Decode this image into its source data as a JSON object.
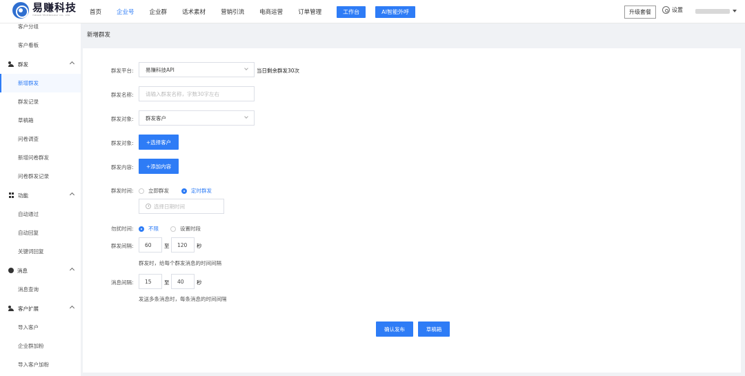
{
  "brand": {
    "name": "易赚科技",
    "sub": "YIZUAN TECHNOLOGY CO., LTD."
  },
  "nav": {
    "items": [
      "首页",
      "企业号",
      "企业群",
      "话术素材",
      "营销引流",
      "电商运营",
      "订单管理"
    ],
    "workbench": "工作台",
    "ai_call": "AI智能外呼",
    "upgrade": "升级套餐",
    "settings": "设置"
  },
  "sidebar": {
    "top_items": [
      "客户分组",
      "客户看板"
    ],
    "groups": [
      {
        "title": "群发",
        "icon": "users-icon",
        "items": [
          "新增群发",
          "群发记录",
          "草稿箱",
          "问卷调查",
          "新增问卷群发",
          "问卷群发记录"
        ]
      },
      {
        "title": "功能",
        "icon": "grid-icon",
        "items": [
          "自动通过",
          "自动回复",
          "关键词回复"
        ]
      },
      {
        "title": "消息",
        "icon": "message-icon",
        "items": [
          "消息查询"
        ]
      },
      {
        "title": "客户扩展",
        "icon": "user-add-icon",
        "items": [
          "导入客户",
          "企业群加粉",
          "导入客户加粉"
        ]
      }
    ]
  },
  "page": {
    "title": "新增群发"
  },
  "form": {
    "platform": {
      "label": "群发平台:",
      "value": "易赚科技API",
      "hint": "当日剩余群发30次"
    },
    "name": {
      "label": "群发名称:",
      "placeholder": "请输入群发名称，字数30字左右"
    },
    "target_select": {
      "label": "群发对象:",
      "value": "群发客户"
    },
    "target_pick": {
      "label": "群发对象:",
      "button": "+选择客户"
    },
    "content": {
      "label": "群发内容:",
      "button": "+添加内容"
    },
    "time": {
      "label": "群发时间:",
      "options": [
        "立即群发",
        "定时群发"
      ],
      "selected": 1,
      "picker_placeholder": "选择日期时间"
    },
    "dnd": {
      "label": "勿扰时间:",
      "options": [
        "不限",
        "设置时段"
      ],
      "selected": 0
    },
    "interval": {
      "label": "群发间隔:",
      "min": "60",
      "to": "至",
      "max": "120",
      "unit": "秒",
      "desc": "群发时，给每个群发消息的时间间隔"
    },
    "msg_interval": {
      "label": "消息间隔:",
      "min": "15",
      "to": "至",
      "max": "40",
      "unit": "秒",
      "desc": "发送多条消息时，每条消息的时间间隔"
    },
    "submit": "确认发布",
    "draft": "草稿箱"
  },
  "colors": {
    "accent": "#2e7cf6"
  }
}
